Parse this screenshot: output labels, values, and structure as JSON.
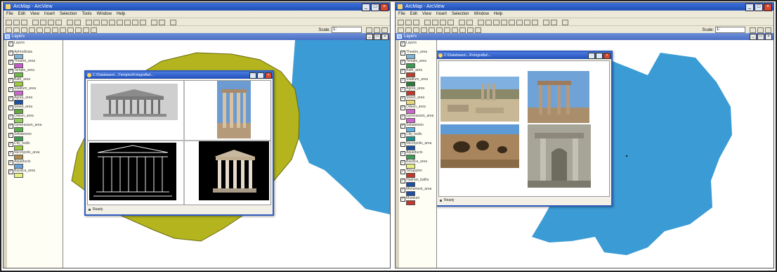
{
  "left_window": {
    "title": "ArcMap - ArcView",
    "menu": [
      "File",
      "Edit",
      "View",
      "Insert",
      "Selection",
      "Tools",
      "Window",
      "Help"
    ],
    "scale_label": "Scale:",
    "scale_value": "1:",
    "doc_title": "Layers",
    "popup_title": "C:\\Databases\\...\\Temples\\Fotograflar\\...",
    "popup_status": "Ready",
    "toc_items": [
      {
        "label": "Layers",
        "color": "#ffffff"
      },
      {
        "label": "Aphrodisias",
        "color": "#7fb3d5"
      },
      {
        "label": "Theatre_area",
        "color": "#c65bc9"
      },
      {
        "label": "Temple_area",
        "color": "#6fb84a"
      },
      {
        "label": "Bath_area",
        "color": "#9ccc3c"
      },
      {
        "label": "Stadium_area",
        "color": "#cc66cc"
      },
      {
        "label": "Agora_area",
        "color": "#1f4fa0"
      },
      {
        "label": "Street_area",
        "color": "#5fa83c"
      },
      {
        "label": "Odeon_area",
        "color": "#8fd05a"
      },
      {
        "label": "Gymnasium_area",
        "color": "#56b04a"
      },
      {
        "label": "Sebasteion",
        "color": "#3c9a52"
      },
      {
        "label": "City_walls",
        "color": "#9ccc3c"
      },
      {
        "label": "Necropolis_area",
        "color": "#b08a4a"
      },
      {
        "label": "Aqueducts",
        "color": "#6a9fd8"
      },
      {
        "label": "Basilica_area",
        "color": "#e8f080"
      }
    ]
  },
  "right_window": {
    "title": "ArcMap - ArcView",
    "menu": [
      "File",
      "Edit",
      "View",
      "Insert",
      "Selection",
      "Window",
      "Help"
    ],
    "scale_label": "Scale:",
    "scale_value": "1:",
    "doc_title": "Layers",
    "popup_title": "C:\\Databases\\...\\Fotograflar\\...",
    "popup_status": "Ready",
    "popup_caption": "",
    "toc_items": [
      {
        "label": "Layers",
        "color": "#ffffff"
      },
      {
        "label": "Theatre_area",
        "color": "#7fb3d5"
      },
      {
        "label": "Temple_area",
        "color": "#3c9a52"
      },
      {
        "label": "Bath_area",
        "color": "#b8422e"
      },
      {
        "label": "Stadium_area",
        "color": "#2c7a3a"
      },
      {
        "label": "Agora_area",
        "color": "#c0392b"
      },
      {
        "label": "Street_area",
        "color": "#e8d87a"
      },
      {
        "label": "Odeon_area",
        "color": "#cc66cc"
      },
      {
        "label": "Gymnasium_area",
        "color": "#cc66cc"
      },
      {
        "label": "Sebasteion",
        "color": "#5fb0e0"
      },
      {
        "label": "City_walls",
        "color": "#1f8f8f"
      },
      {
        "label": "Necropolis_area",
        "color": "#1f4fa0"
      },
      {
        "label": "Aqueducts",
        "color": "#3c9a52"
      },
      {
        "label": "Basilica_area",
        "color": "#e8f080"
      },
      {
        "label": "Tetrapylon",
        "color": "#c0392b"
      },
      {
        "label": "Hadrian_baths",
        "color": "#1f4fa0"
      },
      {
        "label": "Monument_area",
        "color": "#1f4fa0"
      },
      {
        "label": "Museum",
        "color": "#c0392b"
      }
    ]
  },
  "colors": {
    "olive_polygon": "#b4b41e",
    "sea_blue": "#3a9bd5",
    "title_blue": "#2150b8"
  }
}
